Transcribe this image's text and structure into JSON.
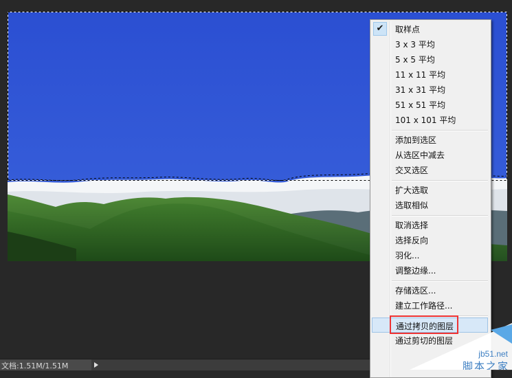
{
  "status_bar": {
    "doc_info": "文档:1.51M/1.51M"
  },
  "menu": {
    "items": [
      {
        "label": "取样点",
        "checked": true
      },
      {
        "label": "3 x 3 平均"
      },
      {
        "label": "5 x 5 平均"
      },
      {
        "label": "11 x 11 平均"
      },
      {
        "label": "31 x 31 平均"
      },
      {
        "label": "51 x 51 平均"
      },
      {
        "label": "101 x 101 平均"
      },
      {
        "label": "添加到选区"
      },
      {
        "label": "从选区中减去"
      },
      {
        "label": "交叉选区"
      },
      {
        "label": "扩大选取"
      },
      {
        "label": "选取相似"
      },
      {
        "label": "取消选择"
      },
      {
        "label": "选择反向"
      },
      {
        "label": "羽化..."
      },
      {
        "label": "调整边缘..."
      },
      {
        "label": "存储选区..."
      },
      {
        "label": "建立工作路径..."
      },
      {
        "label": "通过拷贝的图层",
        "highlighted": true
      },
      {
        "label": "通过剪切的图层"
      }
    ]
  },
  "watermark": {
    "url": "jb51.net",
    "name": "脚本之家"
  },
  "colors": {
    "sky": "#2f55d4",
    "highlight": "#d7e8f8",
    "annotation": "#ee3333",
    "watermark": "#3e7fc2"
  }
}
